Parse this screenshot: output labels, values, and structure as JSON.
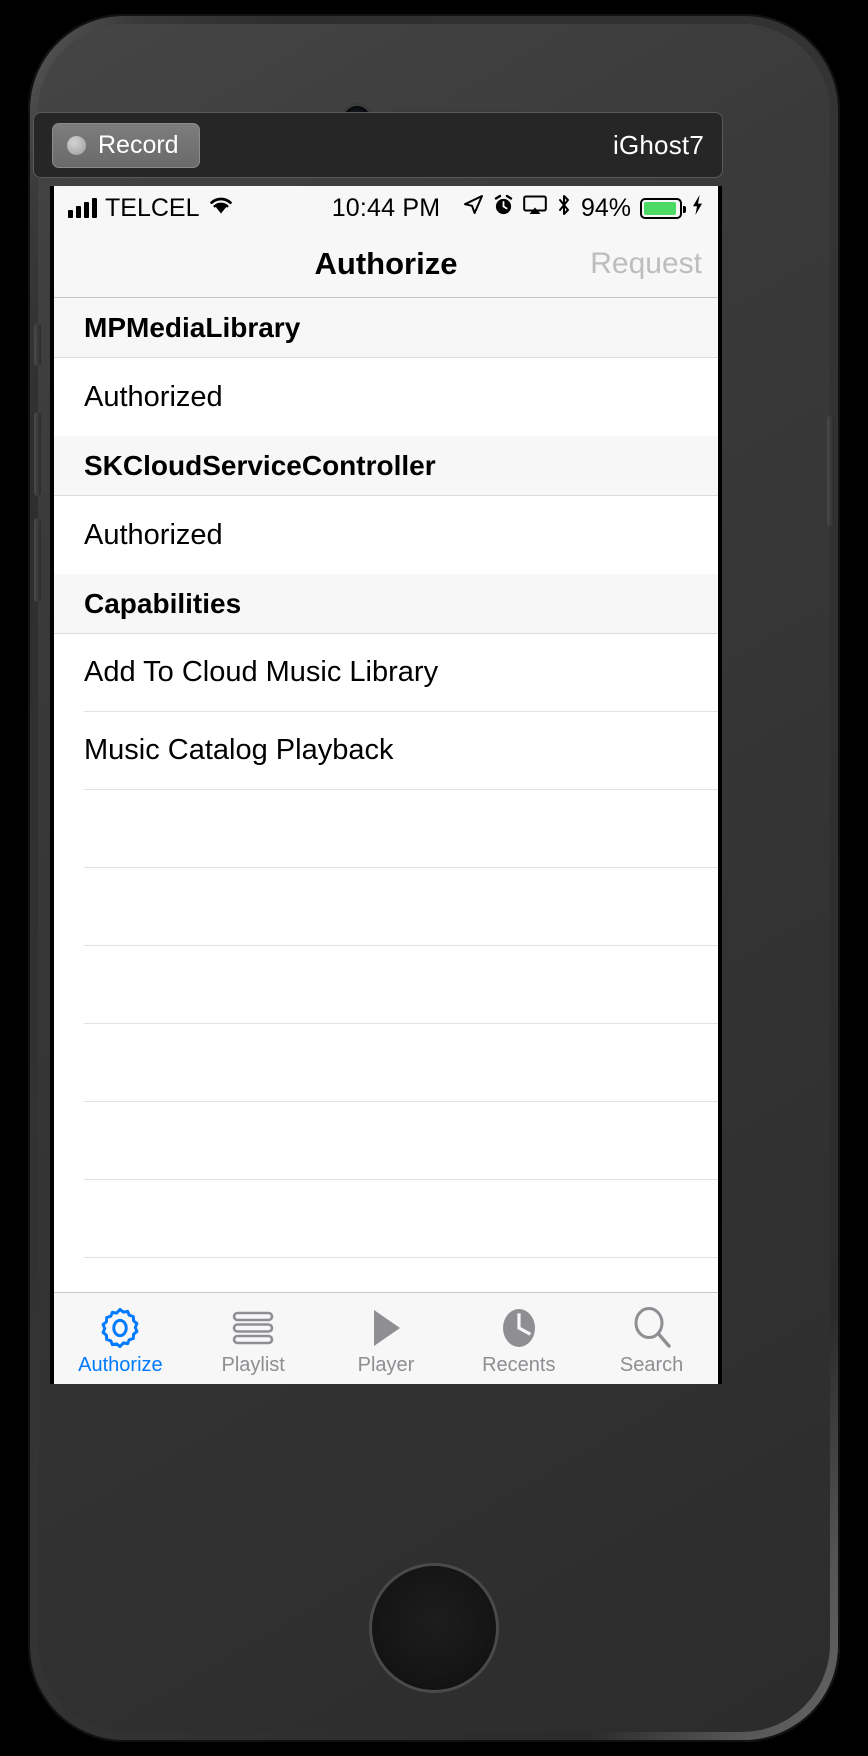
{
  "recorder_bar": {
    "record_label": "Record",
    "device_name": "iGhost7",
    "record_dot_icon": "record-dot-icon"
  },
  "status_bar": {
    "signal_icon": "signal-bars-icon",
    "carrier": "TELCEL",
    "wifi_icon": "wifi-icon",
    "time": "10:44 PM",
    "location_icon": "location-arrow-icon",
    "alarm_icon": "alarm-clock-icon",
    "airplay_icon": "airplay-icon",
    "bluetooth_icon": "bluetooth-icon",
    "battery_percent": "94%",
    "battery_icon": "battery-icon",
    "charging_icon": "lightning-bolt-icon",
    "battery_level": 94,
    "battery_color": "#4cd964"
  },
  "nav_bar": {
    "title": "Authorize",
    "request_label": "Request",
    "request_enabled": false,
    "disabled_color": "#bdbdbd"
  },
  "table": {
    "sections": [
      {
        "header": "MPMediaLibrary",
        "rows": [
          {
            "label": "Authorized",
            "separator": false
          }
        ]
      },
      {
        "header": "SKCloudServiceController",
        "rows": [
          {
            "label": "Authorized",
            "separator": false
          }
        ]
      },
      {
        "header": "Capabilities",
        "rows": [
          {
            "label": "Add To Cloud Music Library",
            "separator": true
          },
          {
            "label": "Music Catalog Playback",
            "separator": true
          }
        ]
      }
    ],
    "empty_row_count": 7
  },
  "tab_bar": {
    "active_color": "#007aff",
    "inactive_color": "#8e8e93",
    "tabs": [
      {
        "label": "Authorize",
        "icon": "gear-icon",
        "active": true
      },
      {
        "label": "Playlist",
        "icon": "list-lines-icon",
        "active": false
      },
      {
        "label": "Player",
        "icon": "play-triangle-icon",
        "active": false
      },
      {
        "label": "Recents",
        "icon": "clock-icon",
        "active": false
      },
      {
        "label": "Search",
        "icon": "magnifier-icon",
        "active": false
      }
    ]
  }
}
